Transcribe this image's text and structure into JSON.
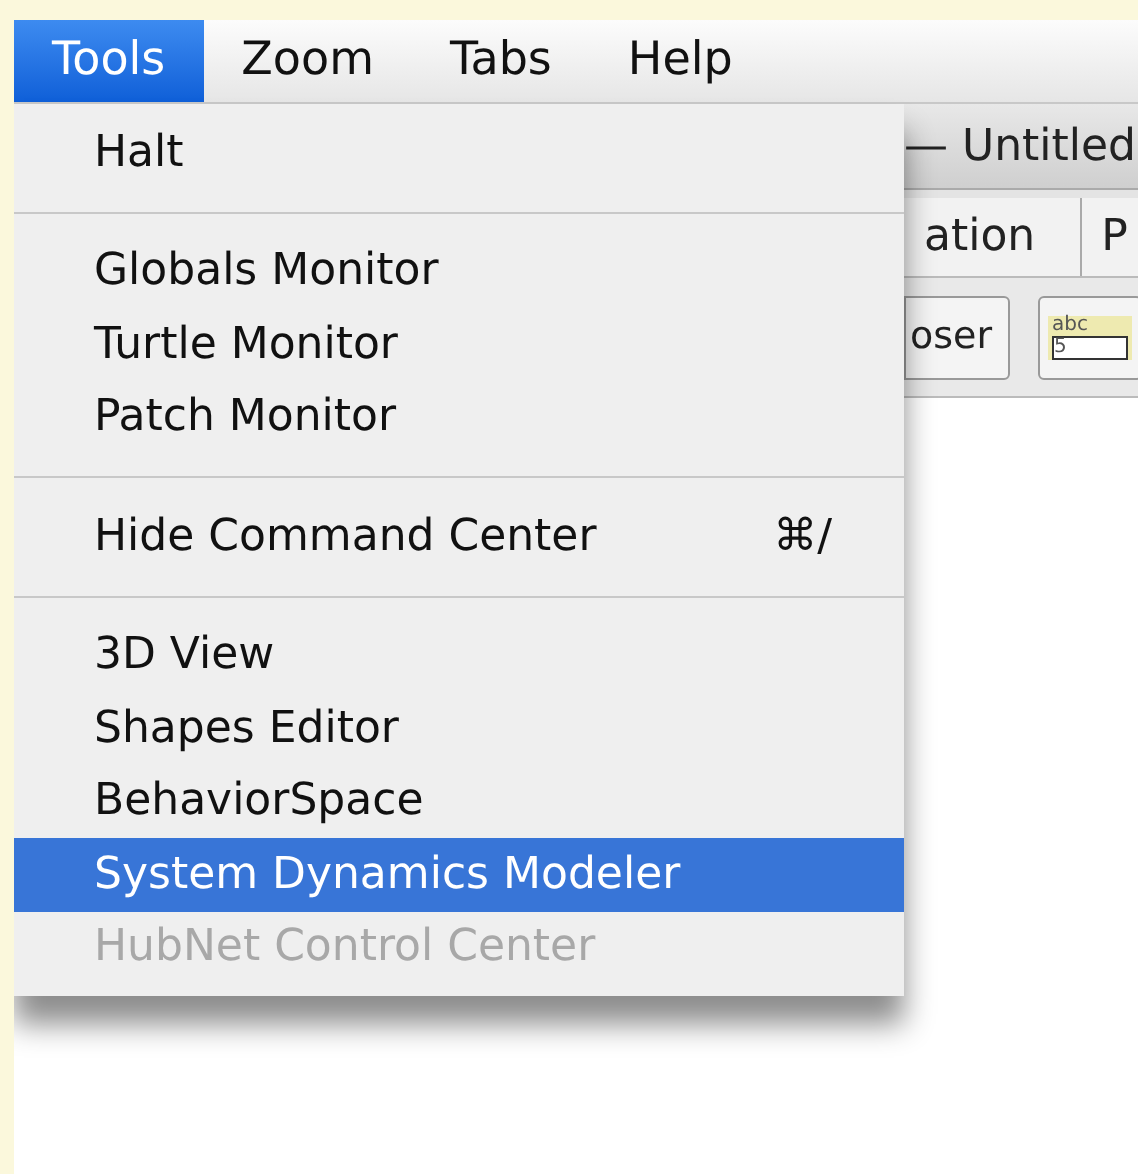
{
  "menu_bar": [
    {
      "label": "Tools",
      "selected": true
    },
    {
      "label": "Zoom",
      "selected": false
    },
    {
      "label": "Tabs",
      "selected": false
    },
    {
      "label": "Help",
      "selected": false
    }
  ],
  "window": {
    "title": "— Untitled",
    "tabs": [
      "ation",
      "P"
    ],
    "toolbar": [
      {
        "kind": "button",
        "label": "oser"
      },
      {
        "kind": "input",
        "label": "abc",
        "value": "5"
      }
    ]
  },
  "menu": [
    {
      "kind": "item",
      "label": "Halt",
      "selected": false,
      "disabled": false
    },
    {
      "kind": "separator"
    },
    {
      "kind": "item",
      "label": "Globals Monitor",
      "selected": false,
      "disabled": false
    },
    {
      "kind": "item",
      "label": "Turtle Monitor",
      "selected": false,
      "disabled": false
    },
    {
      "kind": "item",
      "label": "Patch Monitor",
      "selected": false,
      "disabled": false
    },
    {
      "kind": "separator"
    },
    {
      "kind": "item",
      "label": "Hide Command Center",
      "shortcut": "⌘/",
      "selected": false,
      "disabled": false
    },
    {
      "kind": "separator"
    },
    {
      "kind": "item",
      "label": "3D View",
      "selected": false,
      "disabled": false
    },
    {
      "kind": "item",
      "label": "Shapes Editor",
      "selected": false,
      "disabled": false
    },
    {
      "kind": "item",
      "label": "BehaviorSpace",
      "selected": false,
      "disabled": false
    },
    {
      "kind": "item",
      "label": "System Dynamics Modeler",
      "selected": true,
      "disabled": false
    },
    {
      "kind": "item",
      "label": "HubNet Control Center",
      "selected": false,
      "disabled": true
    }
  ]
}
